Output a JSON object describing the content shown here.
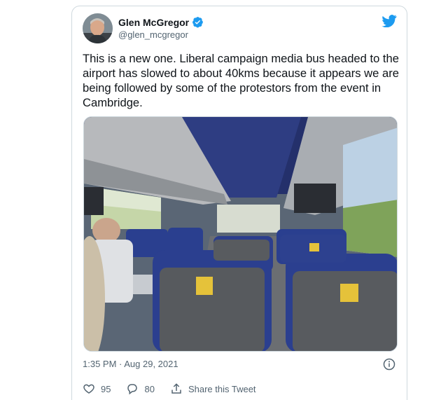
{
  "tweet": {
    "author_name": "Glen McGregor",
    "author_handle": "@glen_mcgregor",
    "text": "This is a new one. Liberal campaign media bus headed to the airport has slowed to about 40kms because it appears we are being followed by some of the protestors from the event in Cambridge.",
    "timestamp": "1:35 PM · Aug 29, 2021",
    "likes": "95",
    "replies": "80",
    "share_label": "Share this Tweet"
  },
  "colors": {
    "brand": "#1d9bf0",
    "text_secondary": "#536471",
    "border": "#cfd9de"
  },
  "icons": [
    "twitter-logo-icon",
    "verified-badge-icon",
    "info-icon",
    "heart-icon",
    "reply-icon",
    "share-icon"
  ]
}
